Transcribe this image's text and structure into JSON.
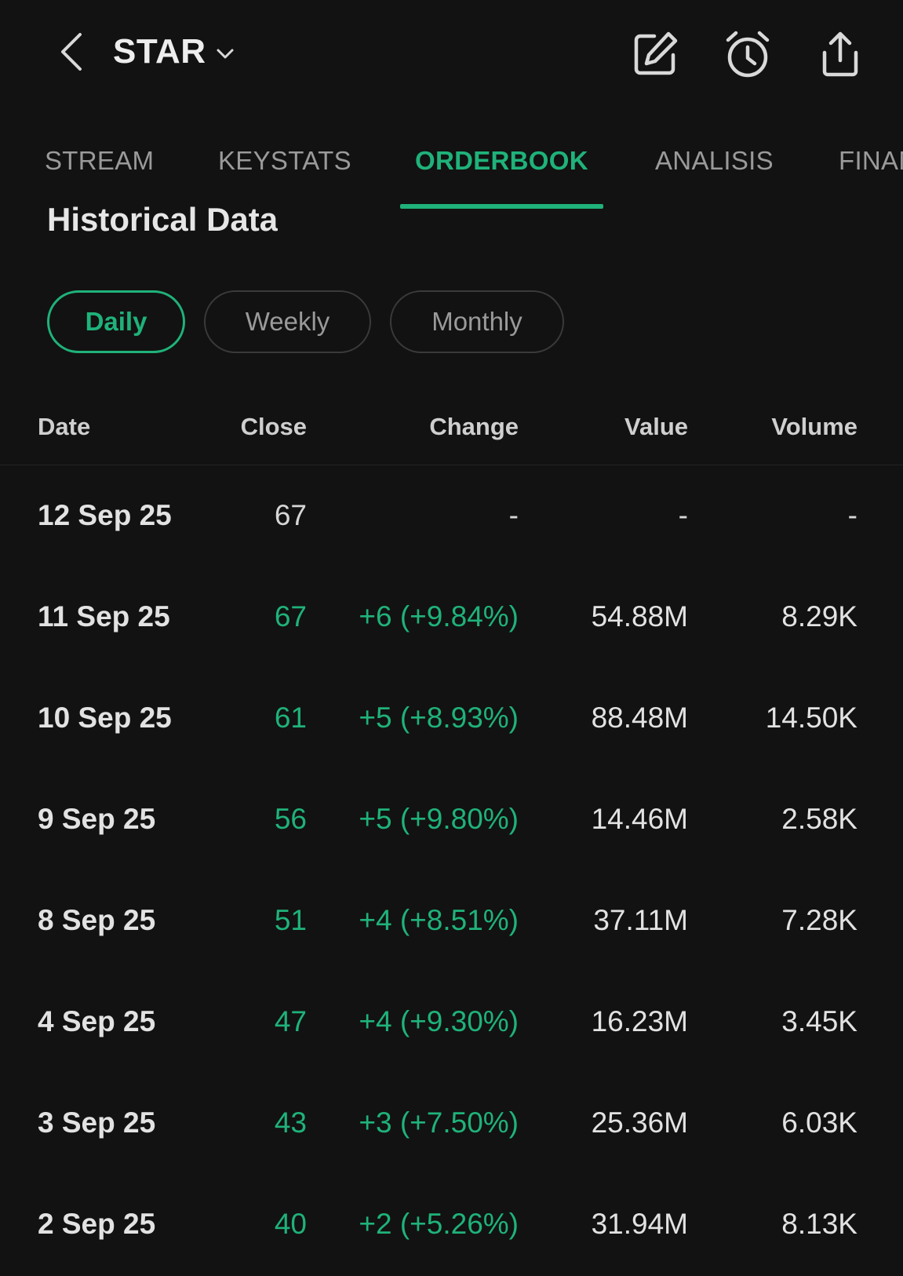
{
  "header": {
    "ticker": "STAR",
    "icons": [
      "chevron-left-icon",
      "chevron-down-icon",
      "edit-icon",
      "alarm-icon",
      "share-icon"
    ]
  },
  "tabs": [
    {
      "label": "STREAM",
      "active": false
    },
    {
      "label": "KEYSTATS",
      "active": false
    },
    {
      "label": "ORDERBOOK",
      "active": true
    },
    {
      "label": "ANALISIS",
      "active": false
    },
    {
      "label": "FINAN",
      "active": false
    }
  ],
  "section": {
    "title": "Historical Data"
  },
  "periods": [
    {
      "label": "Daily",
      "selected": true
    },
    {
      "label": "Weekly",
      "selected": false
    },
    {
      "label": "Monthly",
      "selected": false
    }
  ],
  "table": {
    "headers": {
      "date": "Date",
      "close": "Close",
      "change": "Change",
      "value": "Value",
      "volume": "Volume"
    },
    "rows": [
      {
        "date": "12 Sep 25",
        "close": "67",
        "change": "-",
        "value": "-",
        "volume": "-"
      },
      {
        "date": "11 Sep 25",
        "close": "67",
        "change": "+6 (+9.84%)",
        "value": "54.88M",
        "volume": "8.29K"
      },
      {
        "date": "10 Sep 25",
        "close": "61",
        "change": "+5 (+8.93%)",
        "value": "88.48M",
        "volume": "14.50K"
      },
      {
        "date": "9 Sep 25",
        "close": "56",
        "change": "+5 (+9.80%)",
        "value": "14.46M",
        "volume": "2.58K"
      },
      {
        "date": "8 Sep 25",
        "close": "51",
        "change": "+4 (+8.51%)",
        "value": "37.11M",
        "volume": "7.28K"
      },
      {
        "date": "4 Sep 25",
        "close": "47",
        "change": "+4 (+9.30%)",
        "value": "16.23M",
        "volume": "3.45K"
      },
      {
        "date": "3 Sep 25",
        "close": "43",
        "change": "+3 (+7.50%)",
        "value": "25.36M",
        "volume": "6.03K"
      },
      {
        "date": "2 Sep 25",
        "close": "40",
        "change": "+2 (+5.26%)",
        "value": "31.94M",
        "volume": "8.13K"
      }
    ]
  },
  "colors": {
    "background": "#121212",
    "accent_green": "#1fb27a",
    "text_primary": "#e6e6e6",
    "text_muted": "#9a9a9a"
  }
}
